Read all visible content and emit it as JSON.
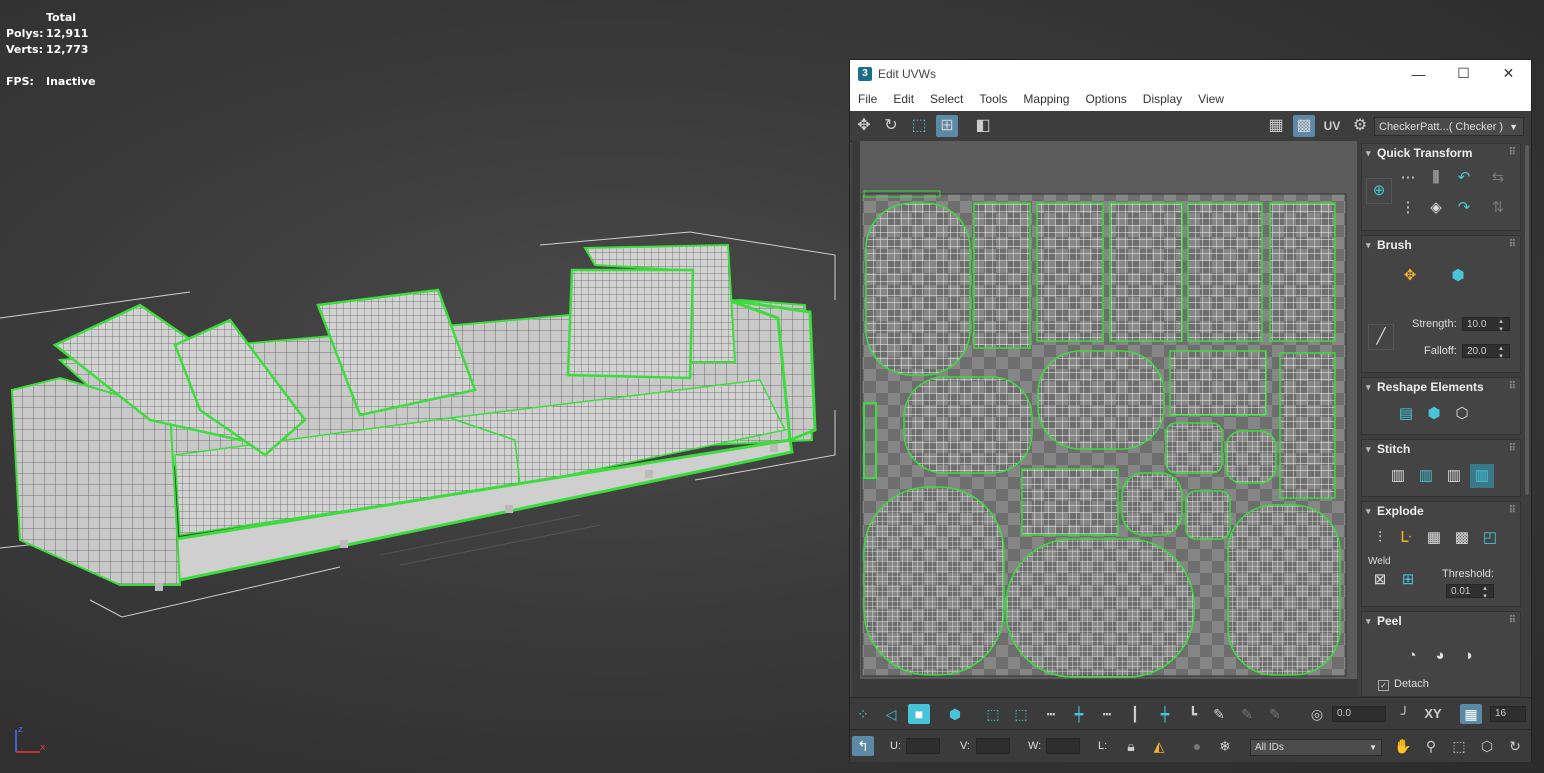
{
  "viewport_stats": {
    "header": "Total",
    "polys_label": "Polys:",
    "polys_value": "12,911",
    "verts_label": "Verts:",
    "verts_value": "12,773",
    "fps_label": "FPS:",
    "fps_value": "Inactive"
  },
  "axis": {
    "x": "x",
    "z": "z"
  },
  "window": {
    "app_icon": "3",
    "title": "Edit UVWs",
    "minimize": "—",
    "maximize": "☐",
    "close": "✕"
  },
  "menu": [
    "File",
    "Edit",
    "Select",
    "Tools",
    "Mapping",
    "Options",
    "Display",
    "View"
  ],
  "toolbar": {
    "uv_label": "UV",
    "texture_dropdown": "CheckerPatt...( Checker )"
  },
  "panel": {
    "quick_transform": "Quick Transform",
    "brush": "Brush",
    "strength_label": "Strength:",
    "strength_value": "10.0",
    "falloff_label": "Falloff:",
    "falloff_value": "20.0",
    "reshape": "Reshape Elements",
    "stitch": "Stitch",
    "explode": "Explode",
    "weld_label": "Weld",
    "threshold_label": "Threshold:",
    "threshold_value": "0.01",
    "peel": "Peel",
    "detach_label": "Detach",
    "detach_checked": true
  },
  "bottom": {
    "rotate_value": "0.0",
    "xy_label": "XY",
    "grid_value": "16",
    "u_label": "U:",
    "v_label": "V:",
    "w_label": "W:",
    "l_label": "L:",
    "ids_value": "All IDs"
  },
  "colors": {
    "viewport_bg": "#3a3a3a",
    "selection_green": "#3ddc3d",
    "accent_blue": "#48c4d8",
    "active_button": "#5b8aa6"
  }
}
